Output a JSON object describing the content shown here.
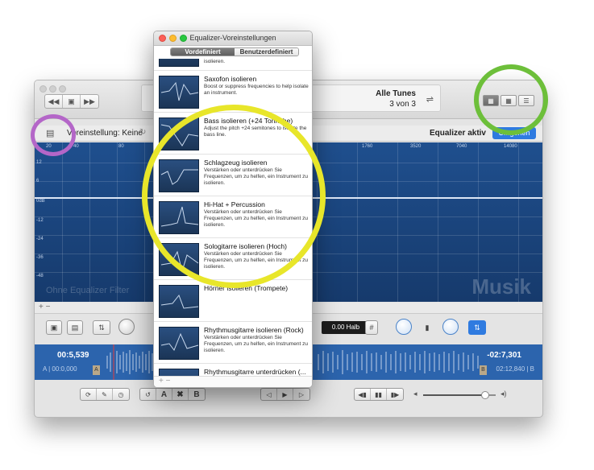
{
  "main": {
    "lcd_title": "Alle Tunes",
    "lcd_subtitle": "3 von 3",
    "preset_label": "Voreinstellung: Keine",
    "eq_active_label": "Equalizer aktiv",
    "eq_button_label": "Umgehen",
    "freq_labels": [
      "20",
      "40",
      "80",
      "1760",
      "3520",
      "7040",
      "14080"
    ],
    "db_labels": [
      "12",
      "6",
      "0dB",
      "-12",
      "-24",
      "-36",
      "-48"
    ],
    "watermark_left": "Ohne Equalizer Filter",
    "watermark_right": "Musik",
    "plus_minus": "+ −",
    "pitch_display": "0.00 Halb",
    "sharp_symbol": "#",
    "time_elapsed": "00:5,539",
    "time_start": "A | 00:0,000",
    "time_remaining": "-02:7,301",
    "time_end": "02:12,840 | B",
    "marker_a": "A",
    "marker_b": "B",
    "abx_labels": [
      "A",
      "✖",
      "B"
    ],
    "volume_level": 0.85
  },
  "presets_window": {
    "title": "Equalizer-Voreinstellungen",
    "tabs": [
      "Vordefiniert",
      "Benutzerdefiniert"
    ],
    "items": [
      {
        "title": "",
        "desc": "Frequenzen, um zu helfen, ein Instrument zu isolieren."
      },
      {
        "title": "Saxofon isolieren",
        "desc": "Boost or suppress frequencies to help isolate an instrument."
      },
      {
        "title": "Bass isolieren (+24 Tonhöhe)",
        "desc": "Adjust the pitch +24 semitones to isolate the bass line."
      },
      {
        "title": "Schlagzeug isolieren",
        "desc": "Verstärken oder unterdrücken Sie Frequenzen, um zu helfen, ein Instrument zu isolieren."
      },
      {
        "title": "Hi-Hat + Percussion",
        "desc": "Verstärken oder unterdrücken Sie Frequenzen, um zu helfen, ein Instrument zu isolieren."
      },
      {
        "title": "Sologitarre isolieren (Hoch)",
        "desc": "Verstärken oder unterdrücken Sie Frequenzen, um zu helfen, ein Instrument zu isolieren."
      },
      {
        "title": "Hörner isolieren (Trompete)",
        "desc": ""
      },
      {
        "title": "Rhythmusgitarre isolieren (Rock)",
        "desc": "Verstärken oder unterdrücken Sie Frequenzen, um zu helfen, ein Instrument zu isolieren."
      },
      {
        "title": "Rhythmusgitarre unterdrücken (...",
        "desc": ""
      }
    ],
    "footer": "+ −"
  },
  "annotations": {
    "purple": "#b466c8",
    "green": "#6dbf3a",
    "yellow": "#e8e62a"
  },
  "colors": {
    "eq_blue": "#1f4f8e",
    "wave_blue": "#2c64ad",
    "accent": "#2f7be0"
  }
}
